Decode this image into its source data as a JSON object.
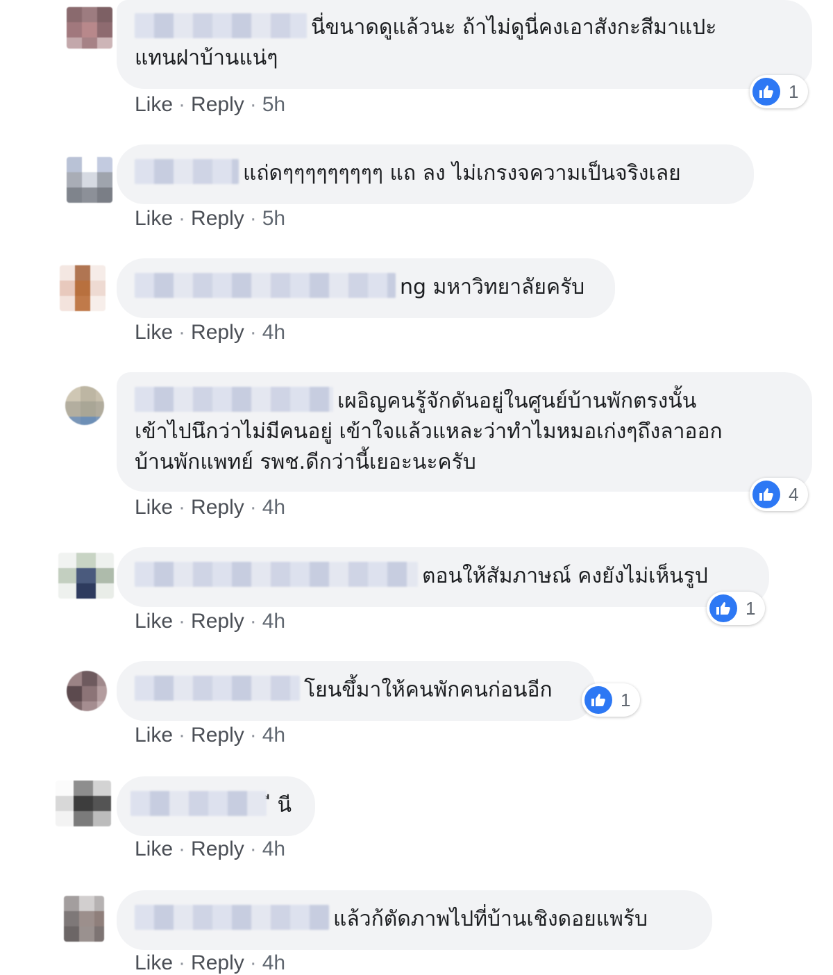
{
  "actions": {
    "like_label": "Like",
    "reply_label": "Reply",
    "separator": "·"
  },
  "comments": [
    {
      "lines": [
        "นี่ขนาดดูแล้วนะ ถ้าไม่ดูนี่คงเอาสังกะสีมาแปะ",
        "แทนฝาบ้านแน่ๆ"
      ],
      "time": "5h",
      "reactions": "1"
    },
    {
      "lines": [
        "แถ่ดๆๆๆๆๆๆๆๆๆ แถ ลง ไม่เกรงจความเป็นจริงเลย"
      ],
      "time": "5h",
      "reactions": ""
    },
    {
      "lines": [
        "ng มหาวิทยาลัยครับ"
      ],
      "time": "4h",
      "reactions": ""
    },
    {
      "lines": [
        "เผอิญคนรู้จักดันอยู่ในศูนย์บ้านพักตรงนั้น",
        "เข้าไปนึกว่าไม่มีคนอยู่ เข้าใจแล้วแหละว่าทำไมหมอเก่งๆถึงลาออก",
        "บ้านพักแพทย์ รพช.ดีกว่านี้เยอะนะครับ"
      ],
      "time": "4h",
      "reactions": "4"
    },
    {
      "lines": [
        "ตอนให้สัมภาษณ์ คงยังไม่เห็นรูป"
      ],
      "time": "4h",
      "reactions": "1"
    },
    {
      "lines": [
        "โยนขึ้มาให้คนพักคนก่อนอีก"
      ],
      "time": "4h",
      "reactions": "1"
    },
    {
      "lines": [
        "ี นี"
      ],
      "time": "4h",
      "reactions": ""
    },
    {
      "lines": [
        "แล้วก้ตัดภาพไปที่บ้านเชิงดอยแพร้บ"
      ],
      "time": "4h",
      "reactions": ""
    }
  ],
  "icons": {
    "reaction": "thumbs-up-icon"
  },
  "colors": {
    "bubble": "#f2f3f5",
    "like_blue": "#2d78f4",
    "meta_text": "#606770"
  }
}
